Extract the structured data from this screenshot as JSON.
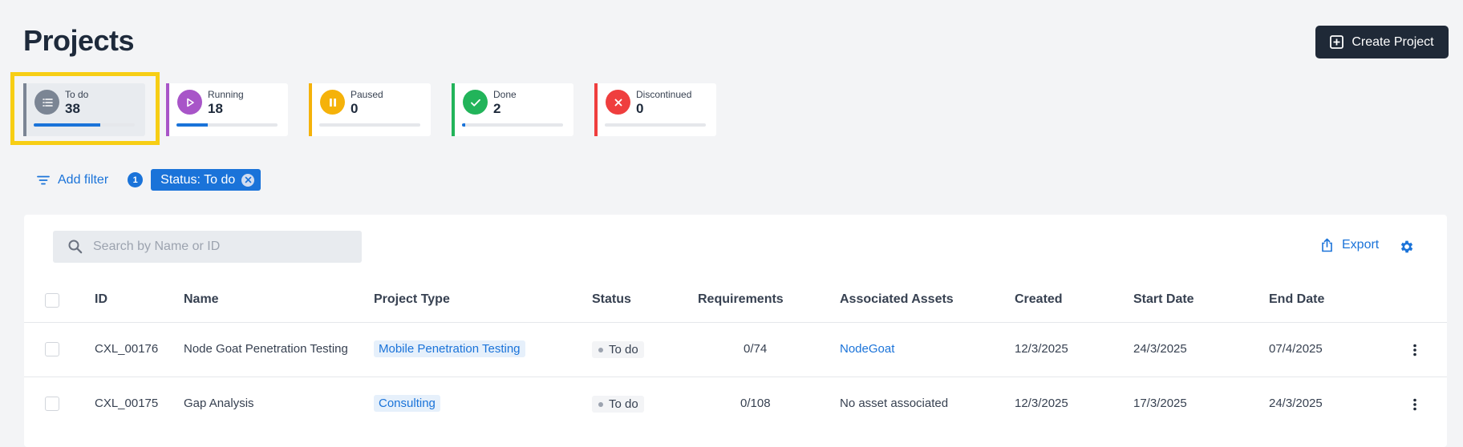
{
  "header": {
    "title": "Projects",
    "create_label": "Create Project"
  },
  "stats": [
    {
      "label": "To do",
      "count": "38",
      "color": "#7b8594",
      "icon": "list-icon",
      "progress": 0.66,
      "selected": true
    },
    {
      "label": "Running",
      "count": "18",
      "color": "#a855c8",
      "icon": "play-icon",
      "progress": 0.31
    },
    {
      "label": "Paused",
      "count": "0",
      "color": "#f5b20a",
      "icon": "pause-icon",
      "progress": 0
    },
    {
      "label": "Done",
      "count": "2",
      "color": "#22b45a",
      "icon": "check-icon",
      "progress": 0.03
    },
    {
      "label": "Discontinued",
      "count": "0",
      "color": "#ef3e3e",
      "icon": "close-icon",
      "progress": 0
    }
  ],
  "filters": {
    "add_label": "Add filter",
    "count": "1",
    "chips": [
      {
        "label": "Status: To do"
      }
    ]
  },
  "toolbar": {
    "search_placeholder": "Search by Name or ID",
    "export_label": "Export"
  },
  "table": {
    "columns": [
      "ID",
      "Name",
      "Project Type",
      "Status",
      "Requirements",
      "Associated Assets",
      "Created",
      "Start Date",
      "End Date"
    ],
    "rows": [
      {
        "id": "CXL_00176",
        "name": "Node Goat Penetration Testing",
        "type": "Mobile Penetration Testing",
        "status": "To do",
        "requirements": "0/74",
        "assets": "NodeGoat",
        "assets_link": true,
        "created": "12/3/2025",
        "start": "24/3/2025",
        "end": "07/4/2025"
      },
      {
        "id": "CXL_00175",
        "name": "Gap Analysis",
        "type": "Consulting",
        "status": "To do",
        "requirements": "0/108",
        "assets": "No asset associated",
        "assets_link": false,
        "created": "12/3/2025",
        "start": "17/3/2025",
        "end": "24/3/2025"
      }
    ]
  },
  "colors": {
    "accent": "#1a73d9",
    "dark": "#1f2937",
    "highlight": "#f7ce15"
  }
}
